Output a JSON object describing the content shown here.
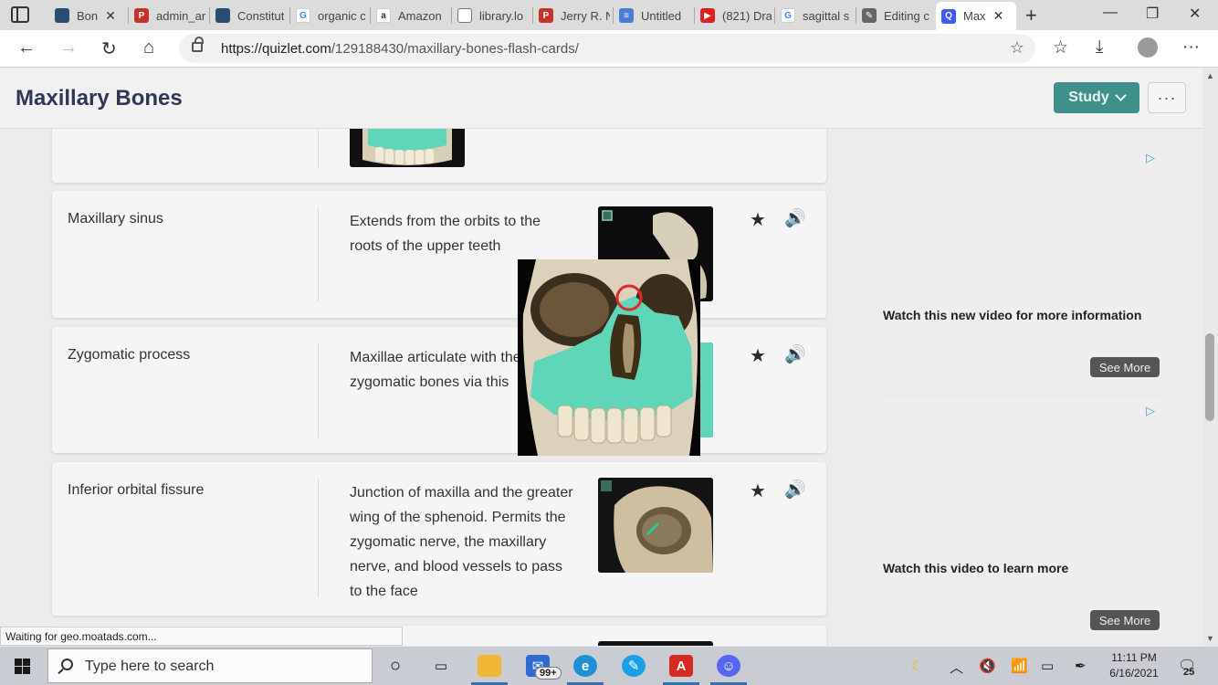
{
  "browser": {
    "tabs": [
      {
        "label": "Bon",
        "icon": "mri-thumbnail-icon",
        "color": "#2a4d6e"
      },
      {
        "label": "admin_ar",
        "icon": "pdf-icon",
        "color": "#c8302a"
      },
      {
        "label": "Constitut",
        "icon": "mri-thumbnail-icon",
        "color": "#2a4d6e"
      },
      {
        "label": "organic c",
        "icon": "google-icon",
        "color": "#4285f4"
      },
      {
        "label": "Amazon",
        "icon": "amazon-icon",
        "color": "#555555"
      },
      {
        "label": "library.lo",
        "icon": "document-icon",
        "color": "#777777"
      },
      {
        "label": "Jerry R. N",
        "icon": "pdf-icon",
        "color": "#c8302a"
      },
      {
        "label": "Untitled",
        "icon": "docs-icon",
        "color": "#4a7bd6"
      },
      {
        "label": "(821) Dra",
        "icon": "youtube-icon",
        "color": "#e02020"
      },
      {
        "label": "sagittal s",
        "icon": "google-icon",
        "color": "#4285f4"
      },
      {
        "label": "Editing c",
        "icon": "edit-icon",
        "color": "#555555"
      },
      {
        "label": "Max",
        "icon": "quizlet-icon",
        "color": "#3d5afe"
      }
    ],
    "url_host": "https://quizlet.com",
    "url_path": "/129188430/maxillary-bones-flash-cards/"
  },
  "page": {
    "title": "Maxillary Bones",
    "study_label": "Study",
    "more_label": "···"
  },
  "cards": [
    {
      "term": "Maxillary sinus",
      "definition": "Extends from the orbits to the roots of the upper teeth"
    },
    {
      "term": "Zygomatic process",
      "definition": "Maxillae articulate with the zygomatic bones via this"
    },
    {
      "term": "Inferior orbital fissure",
      "definition": "Junction of maxilla and the greater wing of the sphenoid. Permits the zygomatic nerve, the maxillary nerve, and blood vessels to pass to the face"
    }
  ],
  "ads": [
    {
      "text": "Watch this new video for more information",
      "button": "See More"
    },
    {
      "text": "Watch this video to learn more",
      "button": "See More"
    }
  ],
  "status_text": "Waiting for geo.moatads.com...",
  "taskbar": {
    "search_placeholder": "Type here to search",
    "mail_badge": "99+",
    "time": "11:11 PM",
    "date": "6/16/2021",
    "notification_count": "25"
  },
  "colors": {
    "accent": "#3f8f8b",
    "bone_highlight": "#5fd6b8"
  }
}
